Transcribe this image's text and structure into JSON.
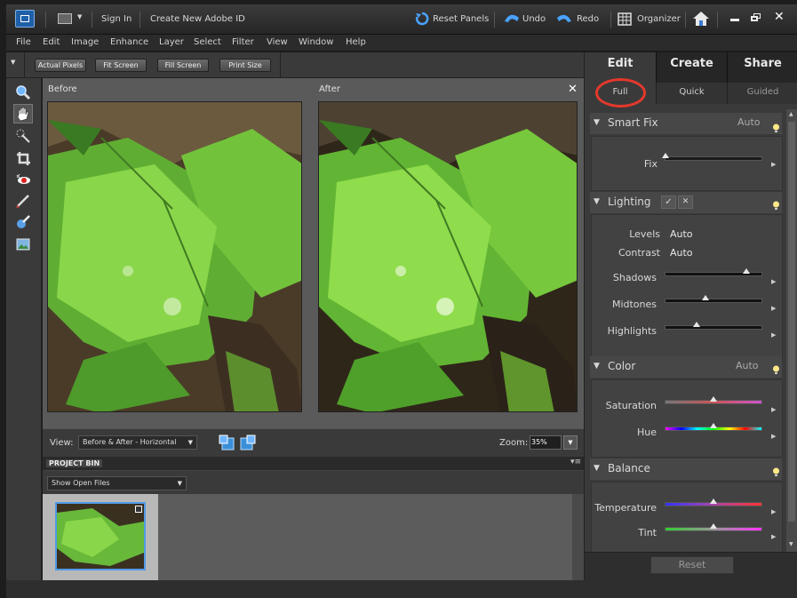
{
  "topbar": {
    "sign_in": "Sign In",
    "create_id": "Create New Adobe ID",
    "reset_panels": "Reset Panels",
    "undo": "Undo",
    "redo": "Redo",
    "organizer": "Organizer"
  },
  "menu": [
    "File",
    "Edit",
    "Image",
    "Enhance",
    "Layer",
    "Select",
    "Filter",
    "View",
    "Window",
    "Help"
  ],
  "options": {
    "actual_pixels": "Actual Pixels",
    "fit_screen": "Fit Screen",
    "fill_screen": "Fill Screen",
    "print_size": "Print Size"
  },
  "panes": {
    "before": "Before",
    "after": "After"
  },
  "viewbar": {
    "view_label": "View:",
    "view_value": "Before & After - Horizontal",
    "zoom_label": "Zoom:",
    "zoom_value": "35%"
  },
  "project_bin": {
    "title": "PROJECT BIN",
    "filter": "Show Open Files"
  },
  "right_panel": {
    "tabs": [
      "Edit",
      "Create",
      "Share"
    ],
    "subtabs": [
      "Full",
      "Quick",
      "Guided"
    ],
    "smart_fix": {
      "title": "Smart Fix",
      "auto": "Auto",
      "fix_label": "Fix",
      "fix_value": 0.0
    },
    "lighting": {
      "title": "Lighting",
      "check": "✓",
      "cancel": "✕",
      "levels_label": "Levels",
      "levels_auto": "Auto",
      "contrast_label": "Contrast",
      "contrast_auto": "Auto",
      "shadows_label": "Shadows",
      "shadows_value": 0.85,
      "midtones_label": "Midtones",
      "midtones_value": 0.42,
      "highlights_label": "Highlights",
      "highlights_value": 0.33
    },
    "color": {
      "title": "Color",
      "auto": "Auto",
      "saturation_label": "Saturation",
      "saturation_value": 0.5,
      "hue_label": "Hue",
      "hue_value": 0.5
    },
    "balance": {
      "title": "Balance",
      "temperature_label": "Temperature",
      "temperature_value": 0.5,
      "tint_label": "Tint",
      "tint_value": 0.5
    },
    "reset": "Reset"
  },
  "colors": {
    "highlight_circle": "#e5382c",
    "panel_bg": "#3a3a3a"
  }
}
